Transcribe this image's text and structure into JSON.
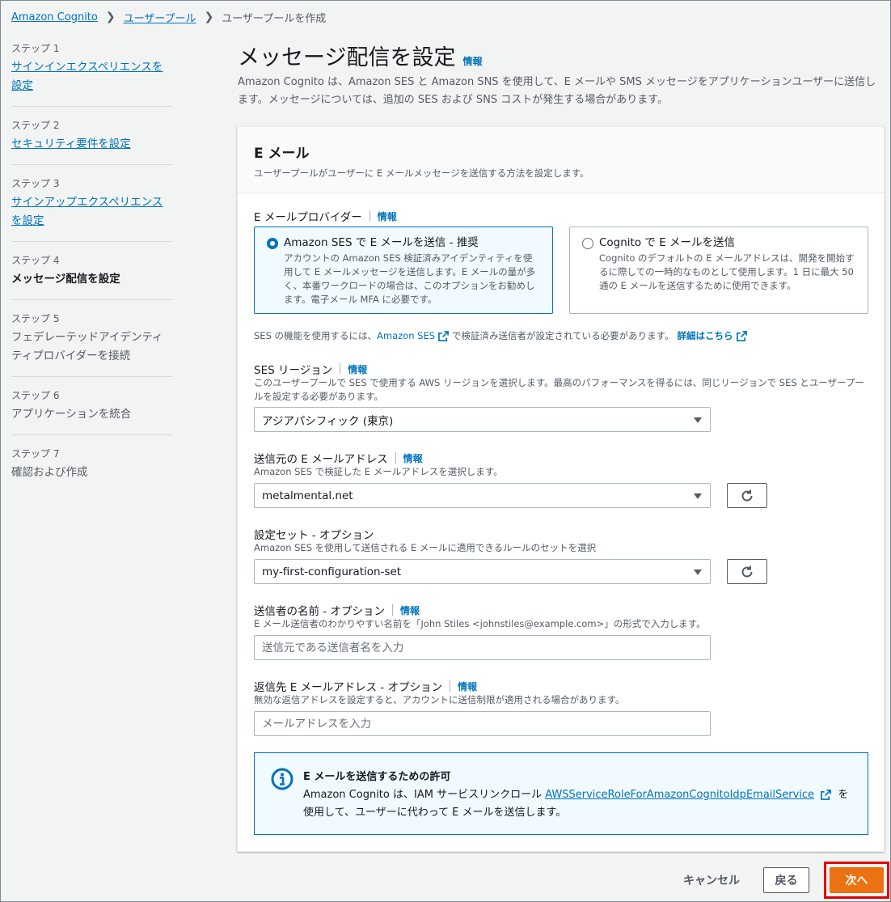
{
  "breadcrumb": {
    "items": [
      "Amazon Cognito",
      "ユーザープール",
      "ユーザープールを作成"
    ]
  },
  "steps": [
    {
      "num": "ステップ 1",
      "title_lines": [
        "サインインエクスペリエンスを",
        "設定"
      ],
      "state": "link"
    },
    {
      "num": "ステップ 2",
      "title_lines": [
        "セキュリティ要件を設定"
      ],
      "state": "link"
    },
    {
      "num": "ステップ 3",
      "title_lines": [
        "サインアップエクスペリエンス",
        "を設定"
      ],
      "state": "link"
    },
    {
      "num": "ステップ 4",
      "title_lines": [
        "メッセージ配信を設定"
      ],
      "state": "current"
    },
    {
      "num": "ステップ 5",
      "title_lines": [
        "フェデレーテッドアイデンティ",
        "ティプロバイダーを接続"
      ],
      "state": "plain"
    },
    {
      "num": "ステップ 6",
      "title_lines": [
        "アプリケーションを統合"
      ],
      "state": "plain"
    },
    {
      "num": "ステップ 7",
      "title_lines": [
        "確認および作成"
      ],
      "state": "plain"
    }
  ],
  "page": {
    "title": "メッセージ配信を設定",
    "info": "情報",
    "description": "Amazon Cognito は、Amazon SES と Amazon SNS を使用して、E メールや SMS メッセージをアプリケーションユーザーに送信します。メッセージについては、追加の SES および SNS コストが発生する場合があります。"
  },
  "email_card": {
    "title": "E メール",
    "subtitle": "ユーザープールがユーザーに E メールメッセージを送信する方法を設定します。",
    "provider": {
      "label": "E メールプロバイダー",
      "info": "情報",
      "options": [
        {
          "title": "Amazon SES で E メールを送信 - 推奨",
          "description": "アカウントの Amazon SES 検証済みアイデンティティを使用して E メールメッセージを送信します。E メールの量が多く、本番ワークロードの場合は、このオプションをお勧めします。電子メール MFA に必要です。",
          "selected": true
        },
        {
          "title": "Cognito で E メールを送信",
          "description": "Cognito のデフォルトの E メールアドレスは、開発を開始するに際しての一時的なものとして使用します。1 日に最大 50 通の E メールを送信するために使用できます。",
          "selected": false
        }
      ]
    },
    "ses_note": {
      "prefix": "SES の機能を使用するには、",
      "link1": "Amazon SES",
      "middle": "で検証済み送信者が設定されている必要があります。",
      "link2": "詳細はこちら"
    },
    "ses_region": {
      "label": "SES リージョン",
      "info": "情報",
      "description": "このユーザープールで SES で使用する AWS リージョンを選択します。最高のパフォーマンスを得るには、同じリージョンで SES とユーザープールを設定する必要があります。",
      "value": "アジアパシフィック (東京)"
    },
    "from_email": {
      "label": "送信元の E メールアドレス",
      "info": "情報",
      "description": "Amazon SES で検証した E メールアドレスを選択します。",
      "value": "metalmental.net"
    },
    "config_set": {
      "label": "設定セット - オプション",
      "description": "Amazon SES を使用して送信される E メールに適用できるルールのセットを選択",
      "value": "my-first-configuration-set"
    },
    "sender_name": {
      "label": "送信者の名前 - オプション",
      "info": "情報",
      "description": "E メール送信者のわかりやすい名前を「John Stiles <johnstiles@example.com>」の形式で入力します。",
      "placeholder": "送信元である送信者名を入力"
    },
    "reply_to": {
      "label": "返信先 E メールアドレス - オプション",
      "info": "情報",
      "description": "無効な返信アドレスを設定すると、アカウントに送信制限が適用される場合があります。",
      "placeholder": "メールアドレスを入力"
    },
    "alert": {
      "title": "E メールを送信するための許可",
      "body_prefix": "Amazon Cognito は、IAM サービスリンクロール",
      "link": "AWSServiceRoleForAmazonCognitoIdpEmailService",
      "body_suffix1": "を",
      "body_suffix2": "使用して、ユーザーに代わって E メールを送信します。"
    }
  },
  "footer": {
    "cancel": "キャンセル",
    "back": "戻る",
    "next": "次へ"
  },
  "colors": {
    "link": "#0073bb",
    "primary_button": "#ec7211",
    "highlight_border": "#e00000"
  }
}
